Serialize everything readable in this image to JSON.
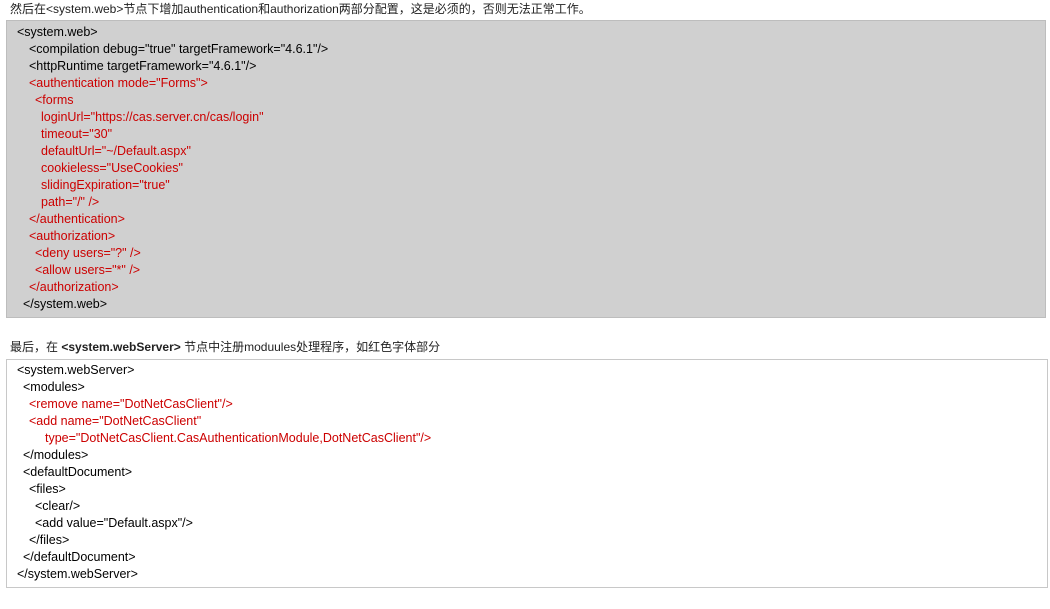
{
  "intro1": {
    "text": "然后在<system.web>节点下增加authentication和authorization两部分配置，这是必须的，否则无法正常工作。"
  },
  "block1": {
    "lines": [
      "<system.web>",
      "<compilation debug=\"true\" targetFramework=\"4.6.1\"/>",
      "<httpRuntime targetFramework=\"4.6.1\"/>",
      "<authentication mode=\"Forms\">",
      "<forms",
      "loginUrl=\"https://cas.server.cn/cas/login\"",
      "timeout=\"30\"",
      "defaultUrl=\"~/Default.aspx\"",
      "cookieless=\"UseCookies\"",
      "slidingExpiration=\"true\"",
      "path=\"/\" />",
      "</authentication>",
      "<authorization>",
      "<deny users=\"?\" />",
      "<allow users=\"*\" />",
      "</authorization>",
      "</system.web>"
    ],
    "colors": [
      "black",
      "black",
      "black",
      "red",
      "red",
      "red",
      "red",
      "red",
      "red",
      "red",
      "red",
      "red",
      "red",
      "red",
      "red",
      "red",
      "black"
    ]
  },
  "intro2": {
    "prefix": "最后，在 ",
    "bold": "<system.webServer>",
    "suffix": " 节点中注册moduules处理程序，如红色字体部分"
  },
  "block2": {
    "lines": [
      "<system.webServer>",
      "<modules>",
      "<remove name=\"DotNetCasClient\"/>",
      "<add name=\"DotNetCasClient\"",
      "type=\"DotNetCasClient.CasAuthenticationModule,DotNetCasClient\"/>",
      "</modules>",
      "<defaultDocument>",
      "<files>",
      "<clear/>",
      "<add value=\"Default.aspx\"/>",
      "</files>",
      "</defaultDocument>",
      "</system.webServer>"
    ],
    "colors": [
      "black",
      "black",
      "red",
      "red",
      "red",
      "black",
      "black",
      "black",
      "black",
      "black",
      "black",
      "black",
      "black"
    ]
  },
  "colors": {
    "red_text": "#cc0000",
    "block1_background": "#d0d0d0",
    "block2_background": "#ffffff"
  }
}
